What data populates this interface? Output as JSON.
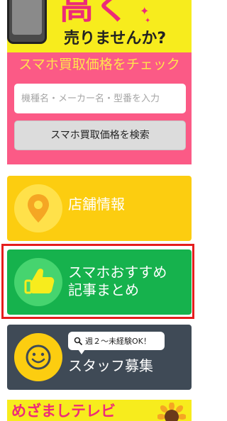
{
  "promo": {
    "big_text": "高く",
    "subtitle": "売りませんか?"
  },
  "banner": {
    "headline": "スマホ買取価格をチェック"
  },
  "search": {
    "placeholder": "機種名・メーカー名・型番を入力",
    "button_label": "スマホ買取価格を検索"
  },
  "tiles": {
    "store": {
      "label": "店舗情報",
      "icon": "map-pin-icon"
    },
    "articles": {
      "line1": "スマホおすすめ",
      "line2": "記事まとめ",
      "icon": "thumbs-up-icon"
    },
    "staff": {
      "badge": "週２～未経験OK！",
      "label": "スタッフ募集",
      "icon": "smiley-icon"
    }
  },
  "tv_banner": {
    "text": "めざましテレビ",
    "icon": "sunflower-icon"
  },
  "colors": {
    "banner_pink": "#fb5a86",
    "headline_yellow": "#ffe44d",
    "store_tile": "#fccd10",
    "articles_tile": "#16b24d",
    "staff_tile": "#3f4a56",
    "highlight_outline": "#e51d1d"
  }
}
